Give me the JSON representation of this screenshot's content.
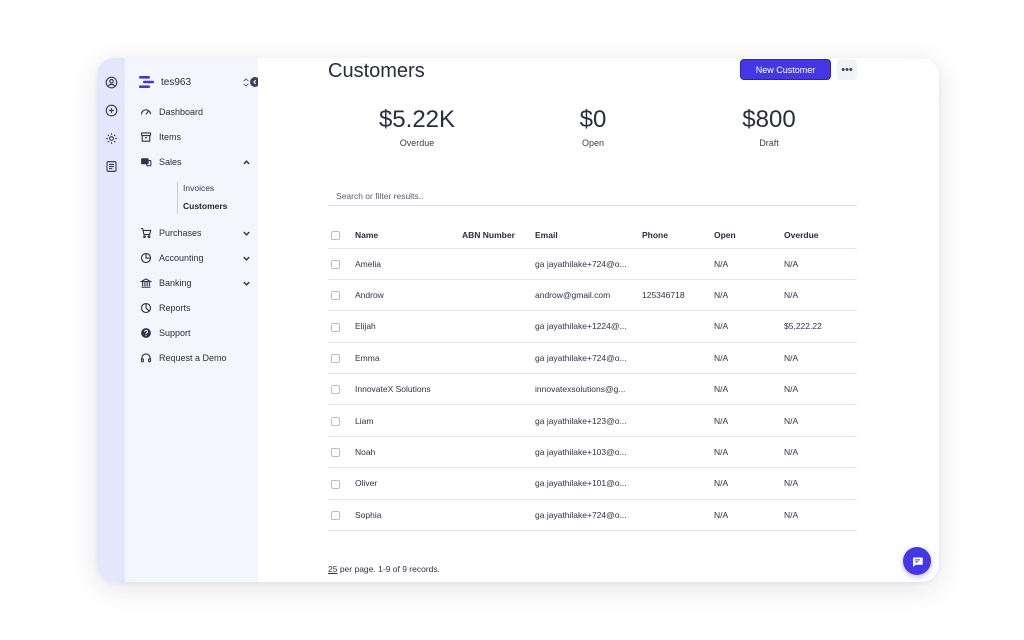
{
  "workspace": {
    "name": "tes963"
  },
  "sidebar": {
    "items": [
      {
        "label": "Dashboard"
      },
      {
        "label": "Items"
      },
      {
        "label": "Sales"
      },
      {
        "label": "Purchases"
      },
      {
        "label": "Accounting"
      },
      {
        "label": "Banking"
      },
      {
        "label": "Reports"
      },
      {
        "label": "Support"
      },
      {
        "label": "Request a Demo"
      }
    ],
    "sales_sub": [
      {
        "label": "Invoices"
      },
      {
        "label": "Customers"
      }
    ]
  },
  "header": {
    "title": "Customers",
    "new_button": "New Customer",
    "more_label": "•••"
  },
  "stats": [
    {
      "amount": "$5.22K",
      "label": "Overdue"
    },
    {
      "amount": "$0",
      "label": "Open"
    },
    {
      "amount": "$800",
      "label": "Draft"
    }
  ],
  "search": {
    "placeholder": "Search or filter results.."
  },
  "table": {
    "columns": [
      "Name",
      "ABN Number",
      "Email",
      "Phone",
      "Open",
      "Overdue"
    ],
    "rows": [
      {
        "name": "Amelia",
        "abn": "",
        "email": "ga jayathilake+724@o...",
        "phone": "",
        "open": "N/A",
        "overdue": "N/A"
      },
      {
        "name": "Androw",
        "abn": "",
        "email": "androw@gmail.com",
        "phone": "125346718",
        "open": "N/A",
        "overdue": "N/A"
      },
      {
        "name": "Elijah",
        "abn": "",
        "email": "ga jayathilake+1224@...",
        "phone": "",
        "open": "N/A",
        "overdue": "$5,222.22"
      },
      {
        "name": "Emma",
        "abn": "",
        "email": "ga jayathilake+724@o...",
        "phone": "",
        "open": "N/A",
        "overdue": "N/A"
      },
      {
        "name": "InnovateX Solutions",
        "abn": "",
        "email": "innovatexsolutions@g...",
        "phone": "",
        "open": "N/A",
        "overdue": "N/A"
      },
      {
        "name": "Liam",
        "abn": "",
        "email": "ga jayathilake+123@o...",
        "phone": "",
        "open": "N/A",
        "overdue": "N/A"
      },
      {
        "name": "Noah",
        "abn": "",
        "email": "ga jayathilake+103@o...",
        "phone": "",
        "open": "N/A",
        "overdue": "N/A"
      },
      {
        "name": "Oliver",
        "abn": "",
        "email": "ga jayathilake+101@o...",
        "phone": "",
        "open": "N/A",
        "overdue": "N/A"
      },
      {
        "name": "Sophia",
        "abn": "",
        "email": "ga jayathilake+724@o...",
        "phone": "",
        "open": "N/A",
        "overdue": "N/A"
      }
    ]
  },
  "pager": {
    "per_page": "25",
    "text": " per page. 1-9 of 9 records."
  },
  "colors": {
    "accent": "#4536e6",
    "rail": "#e3e7fb",
    "sidebar": "#f4f6fe"
  }
}
